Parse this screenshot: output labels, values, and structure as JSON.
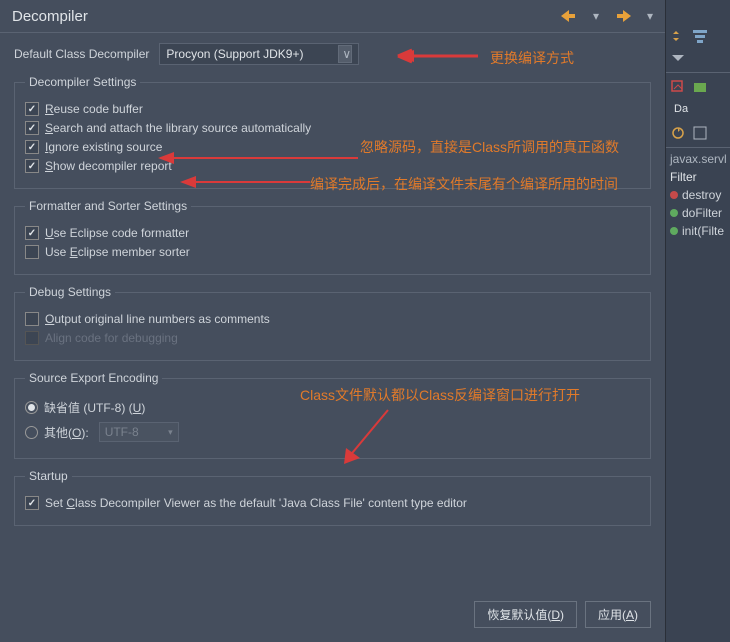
{
  "title": "Decompiler",
  "top_label": "Default Class Decompiler",
  "decompiler_select": "Procyon (Support JDK9+)",
  "groups": {
    "g1": {
      "legend": "Decompiler Settings",
      "c1": {
        "pre": "",
        "u": "R",
        "post": "euse code buffer"
      },
      "c2": {
        "pre": "",
        "u": "S",
        "post": "earch and attach the library source automatically"
      },
      "c3": {
        "pre": "",
        "u": "I",
        "post": "gnore existing source"
      },
      "c4": {
        "pre": "",
        "u": "S",
        "post": "how decompiler report"
      }
    },
    "g2": {
      "legend": "Formatter and Sorter Settings",
      "c1": {
        "pre": "",
        "u": "U",
        "post": "se Eclipse code formatter"
      },
      "c2": {
        "pre": "Use ",
        "u": "E",
        "post": "clipse member sorter"
      }
    },
    "g3": {
      "legend": "Debug Settings",
      "c1": {
        "pre": "",
        "u": "O",
        "post": "utput original line numbers as comments"
      },
      "c2": "Align code for debugging"
    },
    "g4": {
      "legend": "Source Export Encoding",
      "r1": {
        "pre": "缺省值 (UTF-8) (",
        "u": "U",
        "post": ")"
      },
      "r2": {
        "pre": "其他(",
        "u": "O",
        "post": "):"
      },
      "enc": "UTF-8"
    },
    "g5": {
      "legend": "Startup",
      "c1": {
        "pre": "Set ",
        "u": "C",
        "post": "lass Decompiler Viewer as the default 'Java Class File' content type editor"
      }
    }
  },
  "buttons": {
    "restore": {
      "pre": "恢复默认值(",
      "u": "D",
      "post": ")"
    },
    "apply": {
      "pre": "应用(",
      "u": "A",
      "post": ")"
    }
  },
  "annotations": {
    "a1": "更换编译方式",
    "a2": "忽略源码，直接是Class所调用的真正函数",
    "a3": "编译完成后，在编译文件末尾有个编译所用的时间",
    "a4": "Class文件默认都以Class反编译窗口进行打开"
  },
  "side": {
    "label_da": "Da",
    "javax": "javax.servl",
    "filter": "Filter",
    "t1": "destroy",
    "t2": "doFilter",
    "t3": "init(Filte"
  }
}
